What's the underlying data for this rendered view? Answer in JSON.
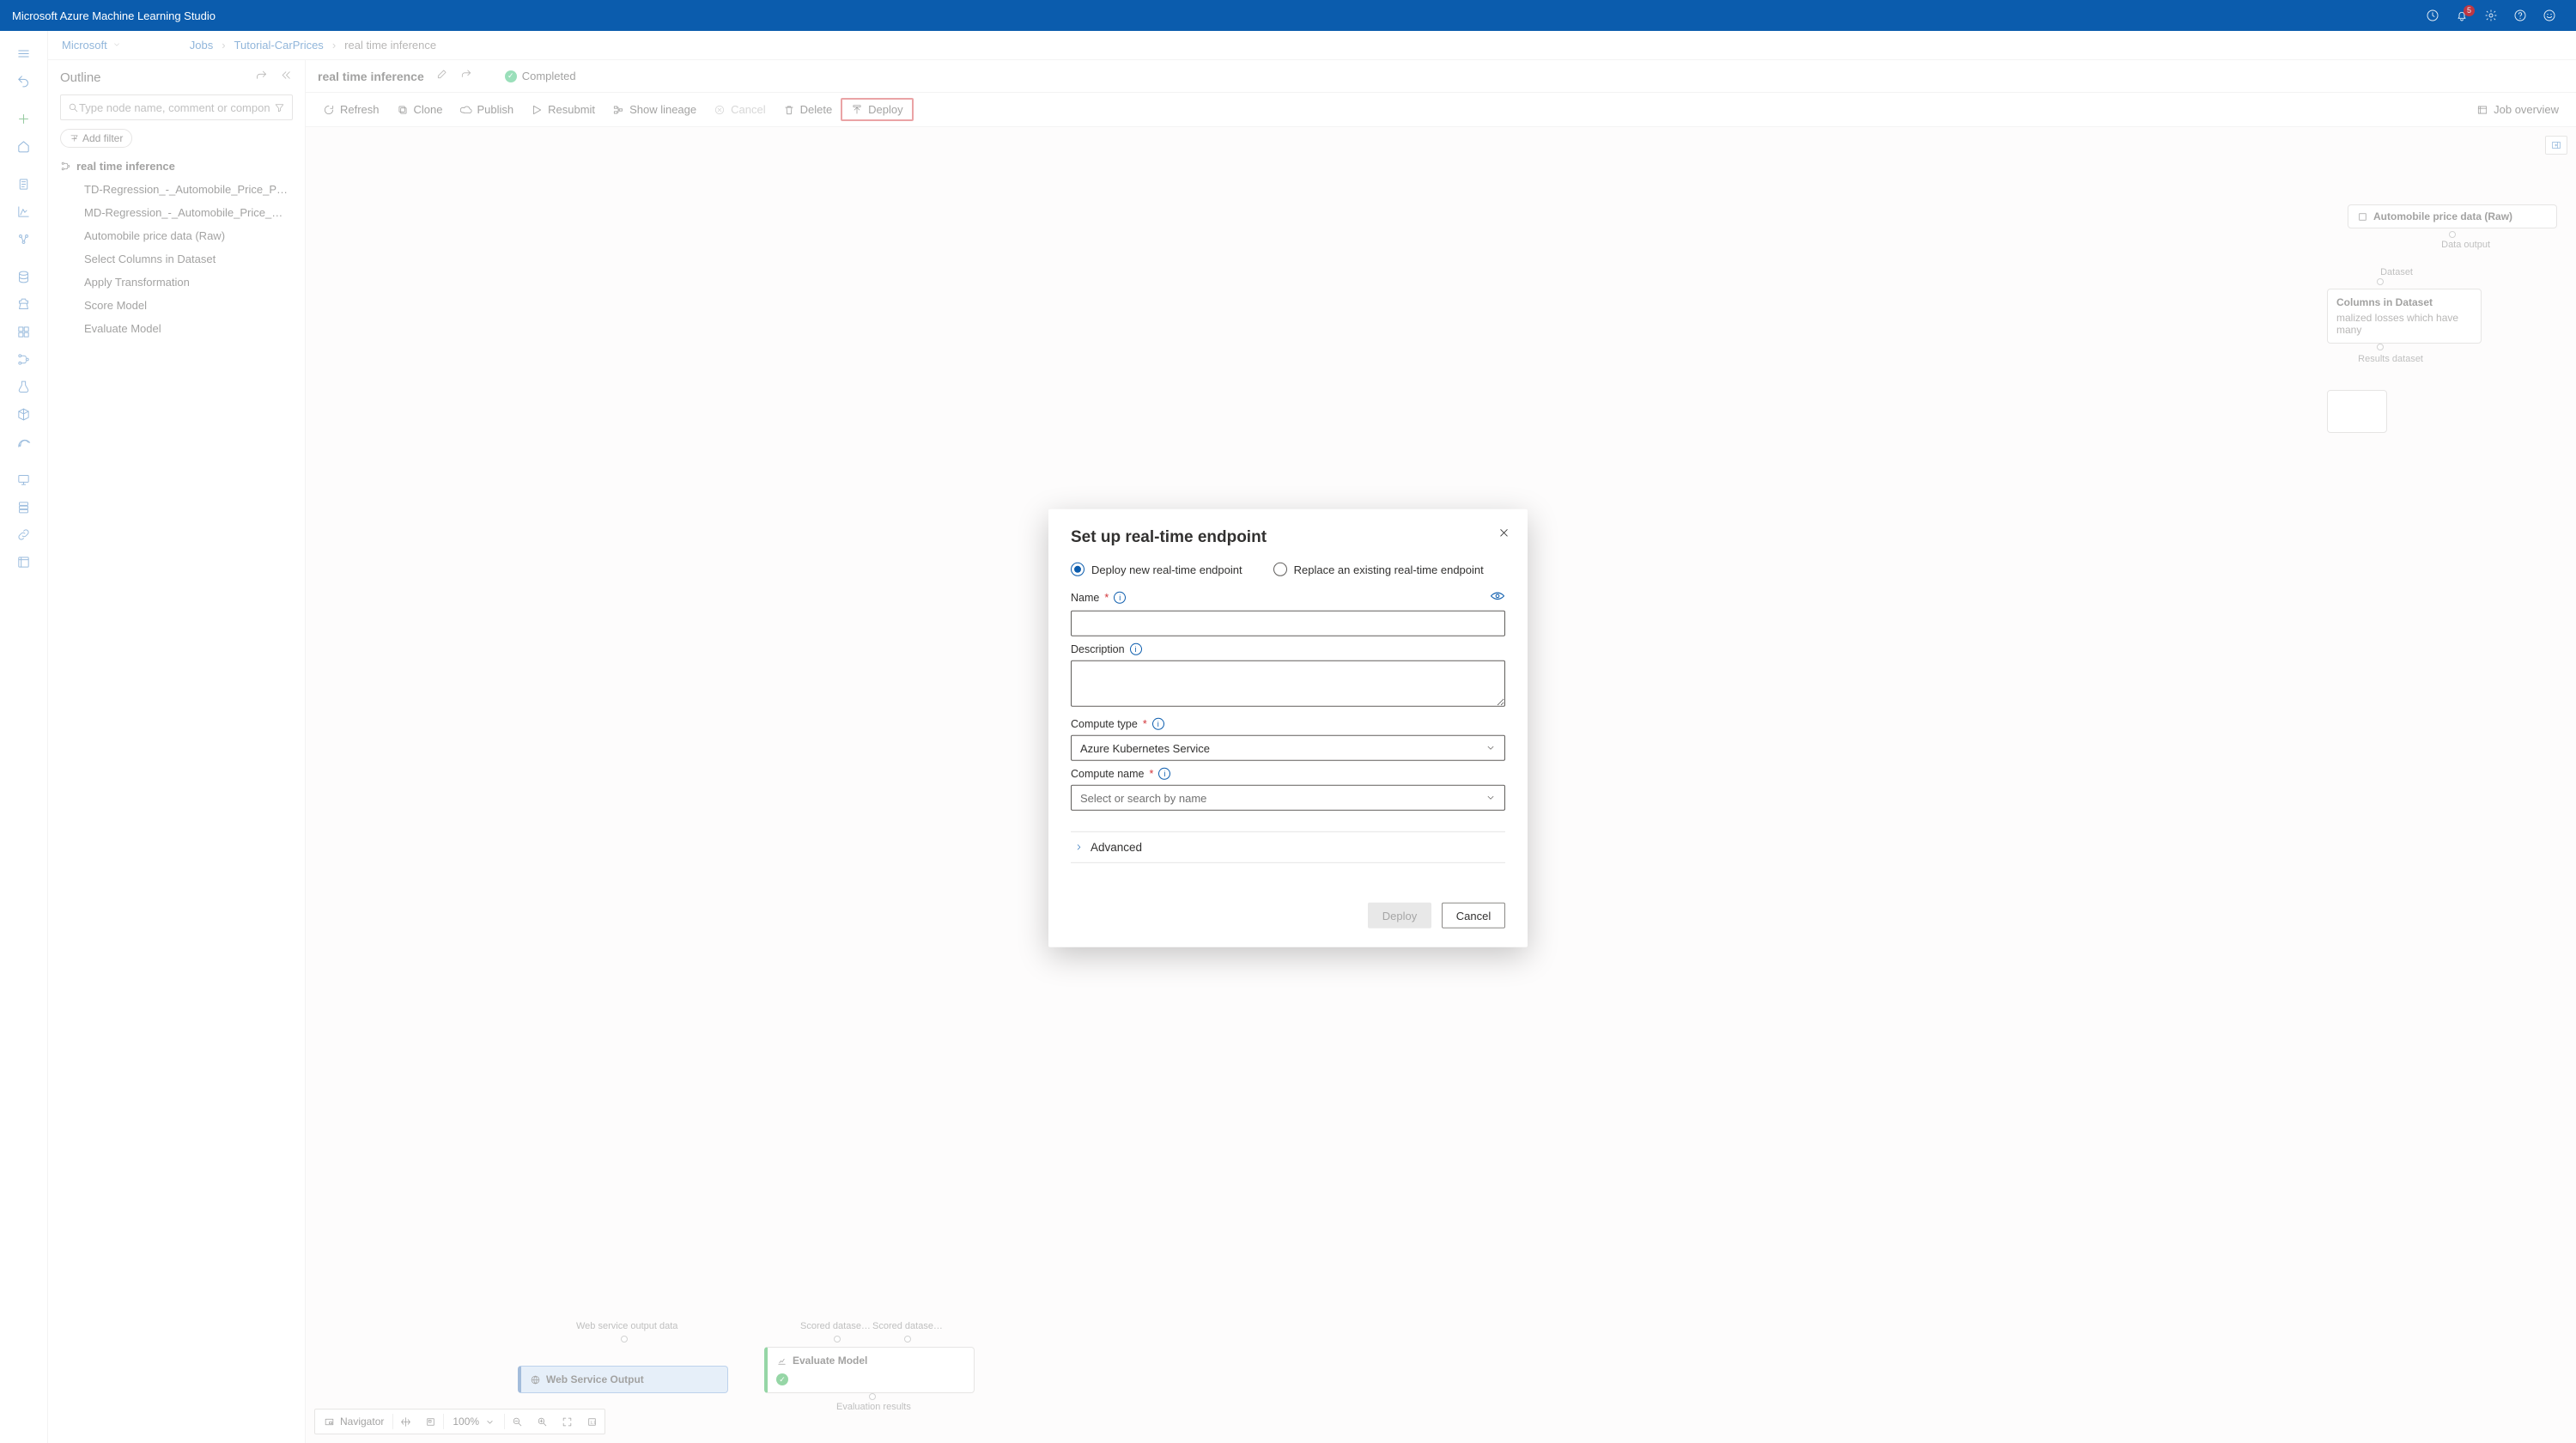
{
  "app_title": "Microsoft Azure Machine Learning Studio",
  "topbar": {
    "notifications_count": "5"
  },
  "breadcrumbs": {
    "items": [
      "Microsoft",
      "Jobs",
      "Tutorial-CarPrices",
      "real time inference"
    ]
  },
  "outline": {
    "title": "Outline",
    "search_placeholder": "Type node name, comment or compon",
    "filter_chip": "Add filter",
    "root_label": "real time inference",
    "items": [
      "TD-Regression_-_Automobile_Price_Predict…",
      "MD-Regression_-_Automobile_Price_Predic…",
      "Automobile price data (Raw)",
      "Select Columns in Dataset",
      "Apply Transformation",
      "Score Model",
      "Evaluate Model"
    ]
  },
  "run": {
    "name": "real time inference",
    "status": "Completed",
    "cmdbar": {
      "refresh": "Refresh",
      "clone": "Clone",
      "publish": "Publish",
      "resubmit": "Resubmit",
      "lineage": "Show lineage",
      "cancel": "Cancel",
      "delete": "Delete",
      "deploy": "Deploy",
      "overview": "Job overview"
    }
  },
  "graph": {
    "node_auto": "Automobile price data (Raw)",
    "label_data_output": "Data output",
    "label_dataset": "Dataset",
    "node_select_cols_title": "Columns in Dataset",
    "node_select_cols_sub": "malized losses which have many",
    "label_results_ds": "Results dataset",
    "label_ws_output_data": "Web service output data",
    "node_ws_output": "Web Service Output",
    "label_scored_ds_left": "Scored datase…",
    "label_scored_ds_right": "Scored datase…",
    "node_eval": "Evaluate Model",
    "label_eval_results": "Evaluation results"
  },
  "navigator": {
    "label": "Navigator",
    "zoom": "100%"
  },
  "dialog": {
    "title": "Set up real-time endpoint",
    "radio_new": "Deploy new real-time endpoint",
    "radio_existing": "Replace an existing real-time endpoint",
    "name_label": "Name",
    "desc_label": "Description",
    "compute_type_label": "Compute type",
    "compute_type_value": "Azure Kubernetes Service",
    "compute_name_label": "Compute name",
    "compute_name_placeholder": "Select or search by name",
    "advanced": "Advanced",
    "deploy": "Deploy",
    "cancel": "Cancel"
  }
}
